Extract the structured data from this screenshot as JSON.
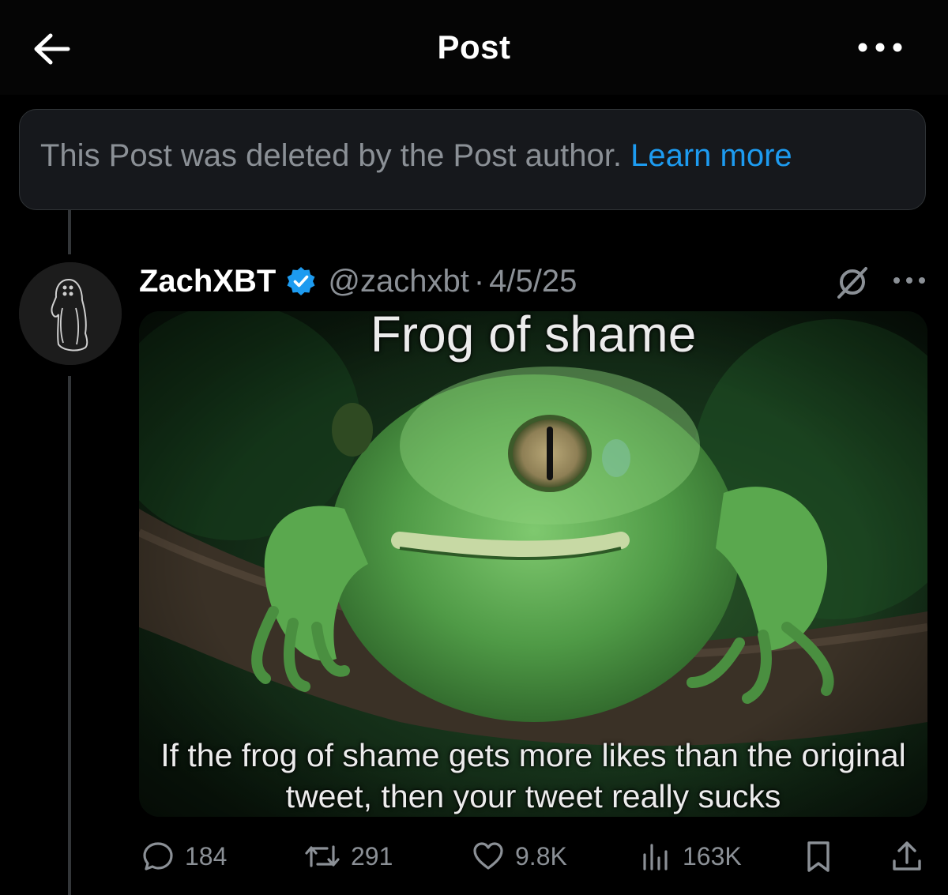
{
  "header": {
    "title": "Post",
    "back_icon": "arrow-left-icon",
    "more_icon": "more-horizontal-icon"
  },
  "notice": {
    "text": "This Post was deleted by the Post author. ",
    "link": "Learn more"
  },
  "tweet": {
    "display_name": "ZachXBT",
    "verified_icon": "verified-badge-icon",
    "handle": "@zachxbt",
    "separator": "·",
    "date": "4/5/25",
    "media": {
      "top_caption": "Frog of shame",
      "bottom_caption": "If the frog of shame gets more likes than the original tweet, then your tweet really sucks"
    },
    "actions": {
      "replies": "184",
      "reposts": "291",
      "likes": "9.8K",
      "views": "163K"
    }
  },
  "colors": {
    "background": "#000000",
    "link": "#1d9bf0",
    "verified": "#1d9bf0",
    "muted_text": "#8b9096"
  }
}
